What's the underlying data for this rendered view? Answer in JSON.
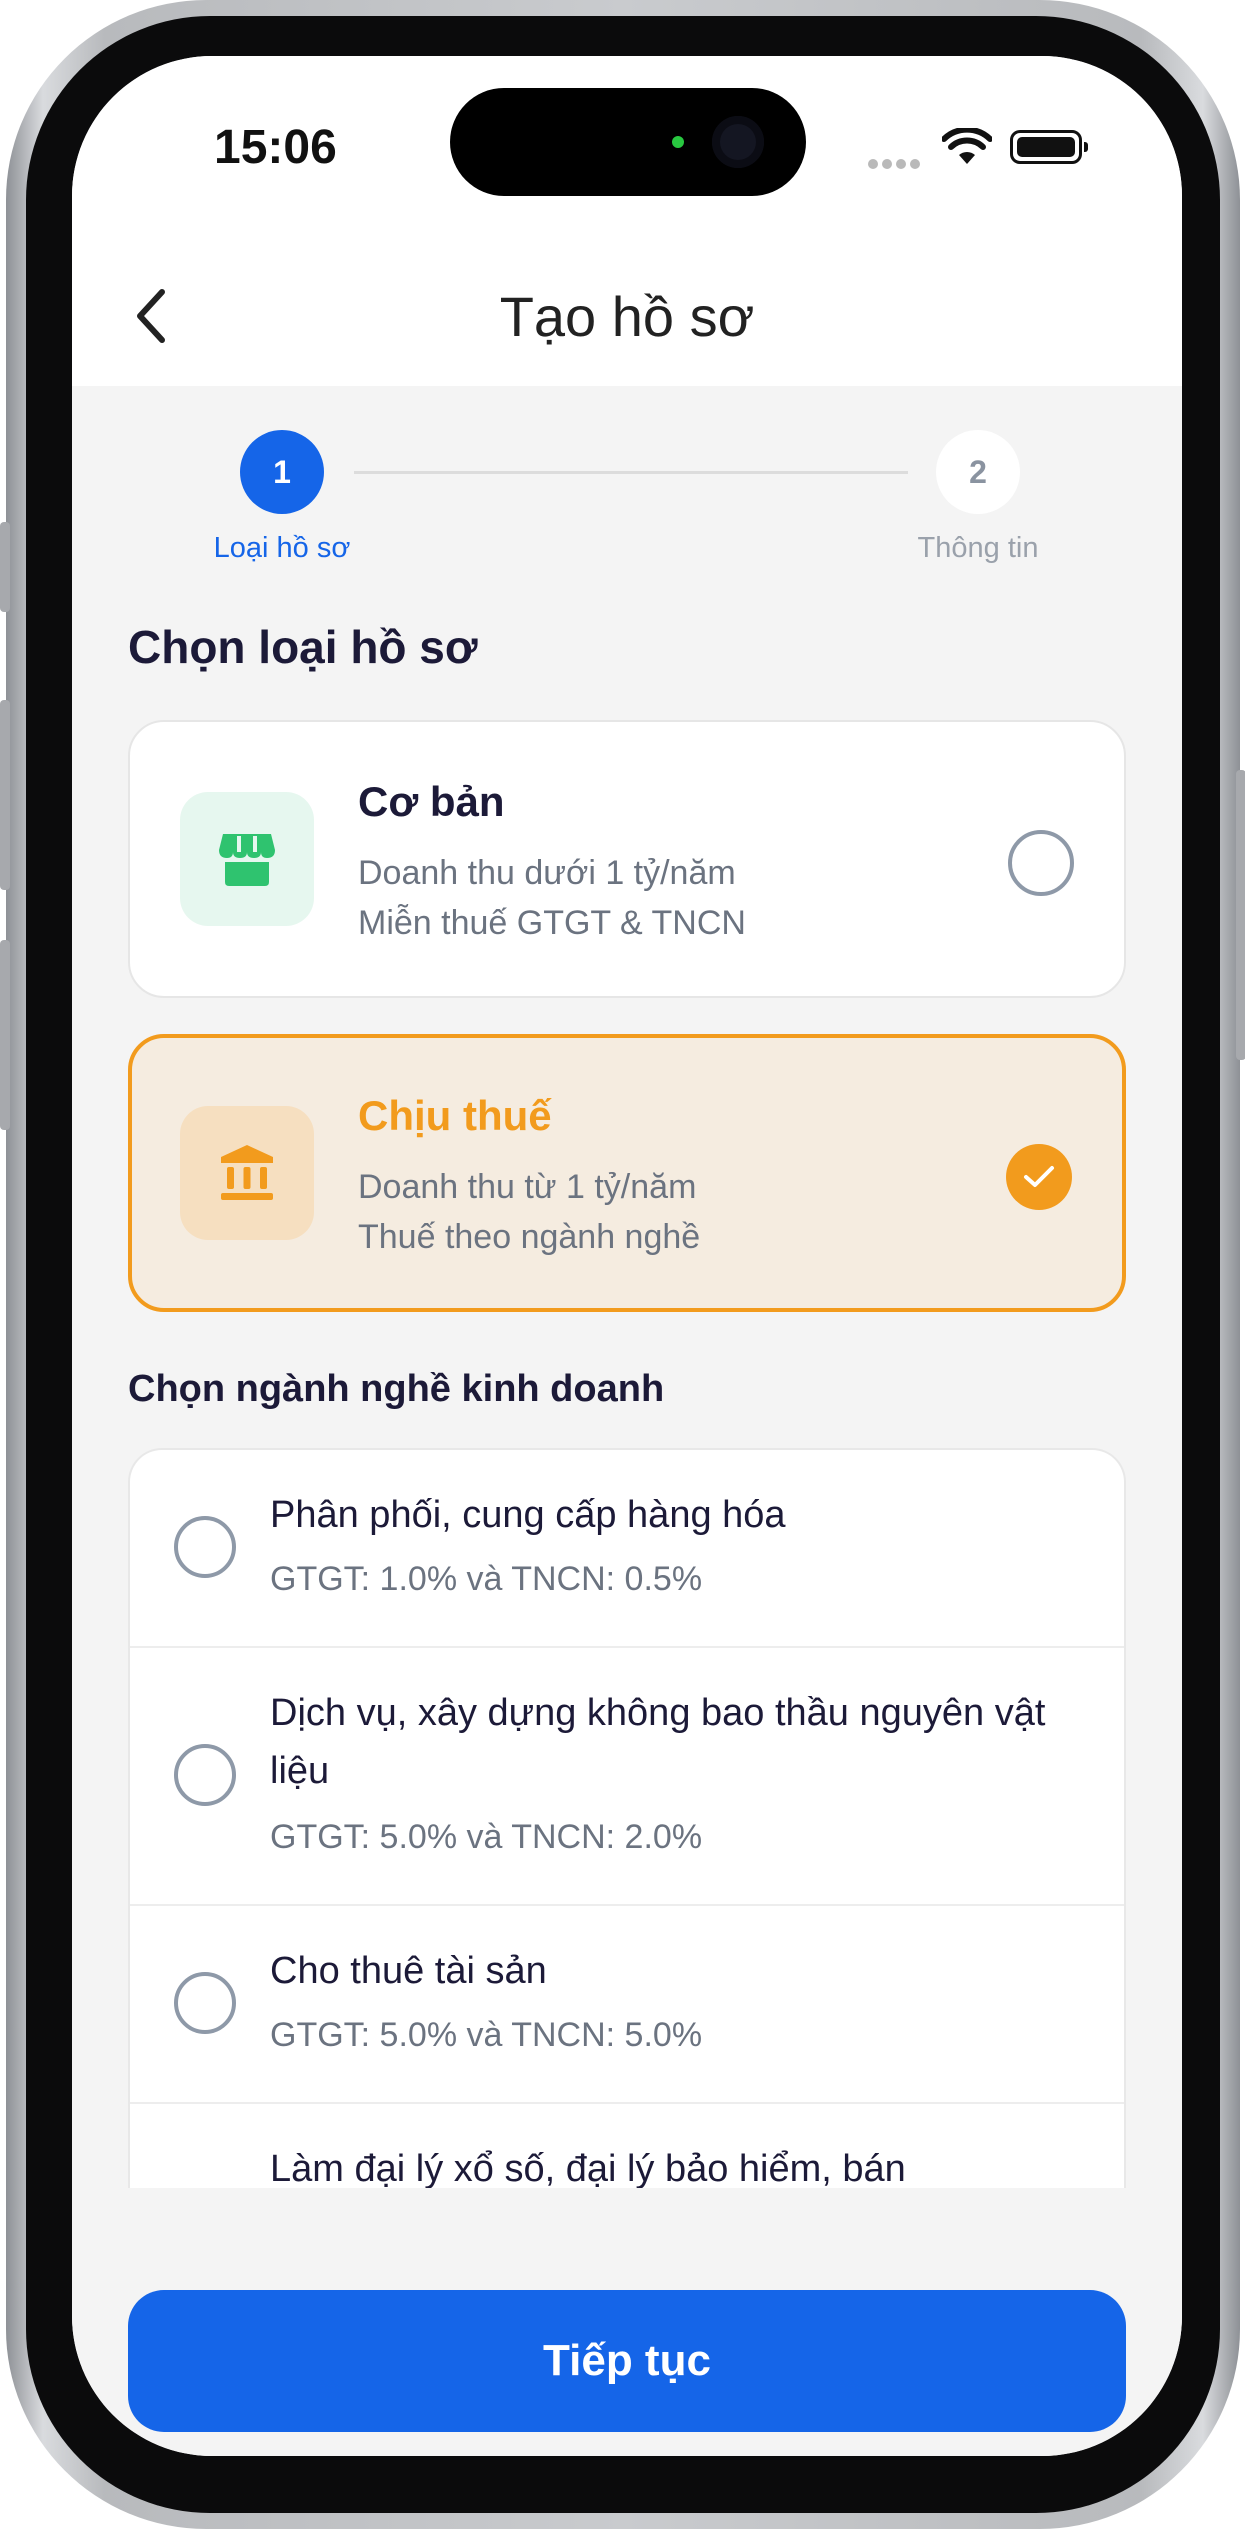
{
  "status_bar": {
    "time": "15:06"
  },
  "header": {
    "title": "Tạo hồ sơ"
  },
  "stepper": {
    "steps": [
      {
        "number": "1",
        "label": "Loại hồ sơ",
        "active": true
      },
      {
        "number": "2",
        "label": "Thông tin",
        "active": false
      }
    ]
  },
  "profile_type": {
    "section_title": "Chọn loại hồ sơ",
    "options": [
      {
        "title": "Cơ bản",
        "desc_line1": "Doanh thu dưới 1 tỷ/năm",
        "desc_line2": "Miễn thuế GTGT & TNCN",
        "icon": "storefront-icon",
        "selected": false
      },
      {
        "title": "Chịu thuế",
        "desc_line1": "Doanh thu từ 1 tỷ/năm",
        "desc_line2": "Thuế theo ngành nghề",
        "icon": "bank-building-icon",
        "selected": true
      }
    ]
  },
  "industry": {
    "section_title": "Chọn ngành nghề kinh doanh",
    "items": [
      {
        "name": "Phân phối, cung cấp hàng hóa",
        "rate": "GTGT: 1.0% và TNCN: 0.5%"
      },
      {
        "name": "Dịch vụ, xây dựng không bao thầu nguyên vật liệu",
        "rate": "GTGT: 5.0% và TNCN: 2.0%"
      },
      {
        "name": "Cho thuê tài sản",
        "rate": "GTGT: 5.0% và TNCN: 5.0%"
      },
      {
        "name": "Làm đại lý xổ số, đại lý bảo hiểm, bán",
        "rate": ""
      }
    ]
  },
  "footer": {
    "continue_label": "Tiếp tục"
  },
  "colors": {
    "primary": "#1565e8",
    "accent_orange": "#f29b1d",
    "success_green": "#2fc36f",
    "text_dark": "#1c1a38",
    "text_muted": "#6b7380"
  }
}
